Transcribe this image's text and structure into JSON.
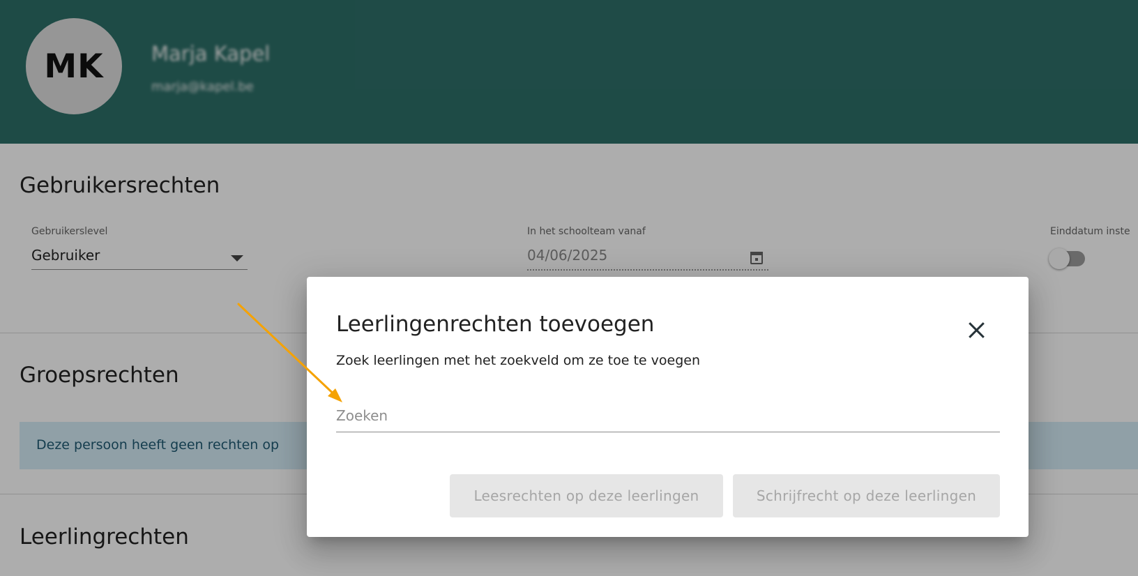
{
  "header": {
    "avatar_initials": "MK",
    "user_name": "Marja Kapel",
    "user_email": "marja@kapel.be",
    "background_color": "#2d6f68"
  },
  "user_rights": {
    "title": "Gebruikersrechten",
    "user_level": {
      "label": "Gebruikerslevel",
      "value": "Gebruiker"
    },
    "school_team_since": {
      "label": "In het schoolteam vanaf",
      "value": "04/06/2025"
    },
    "end_date": {
      "label": "Einddatum inste",
      "enabled": false
    }
  },
  "group_rights": {
    "title": "Groepsrechten",
    "info_text": "Deze persoon heeft geen rechten op"
  },
  "student_rights": {
    "title": "Leerlingrechten"
  },
  "dialog": {
    "title": "Leerlingenrechten toevoegen",
    "subtitle": "Zoek leerlingen met het zoekveld om ze toe te voegen",
    "search_placeholder": "Zoeken",
    "read_button": "Leesrechten op deze leerlingen",
    "write_button": "Schrijfrecht op deze leerlingen"
  },
  "annotation": {
    "color": "#f5a201",
    "points_to": "search-input"
  }
}
